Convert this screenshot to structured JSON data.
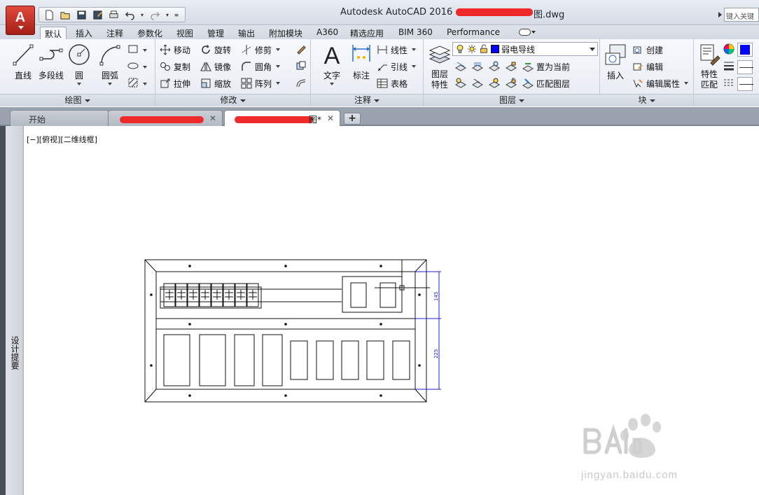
{
  "app": {
    "logo_letter": "A",
    "title": "Autodesk AutoCAD 2016",
    "title_suffix": "图.dwg",
    "search_placeholder": "键入关键"
  },
  "ribbon_tabs": [
    "默认",
    "插入",
    "注释",
    "参数化",
    "视图",
    "管理",
    "输出",
    "附加模块",
    "A360",
    "精选应用",
    "BIM 360",
    "Performance"
  ],
  "panels": {
    "draw": {
      "title": "绘图",
      "line": "直线",
      "polyline": "多段线",
      "circle": "圆",
      "arc": "圆弧"
    },
    "modify": {
      "title": "修改",
      "move": "移动",
      "rotate": "旋转",
      "trim": "修剪",
      "copy": "复制",
      "mirror": "镜像",
      "fillet": "圆角",
      "stretch": "拉伸",
      "scale": "缩放",
      "array": "阵列"
    },
    "annotation": {
      "title": "注释",
      "text": "文字",
      "dimension": "标注",
      "linear": "线性",
      "leader": "引线",
      "table": "表格"
    },
    "layers": {
      "title": "图层",
      "layer_properties": "图层\n特性",
      "current_layer": "弱电导线",
      "set_current": "置为当前",
      "match_layer": "匹配图层"
    },
    "block": {
      "title": "块",
      "insert": "插入",
      "create": "创建",
      "edit": "编辑",
      "edit_attributes": "编辑属性"
    },
    "properties": {
      "match": "特性\n匹配"
    }
  },
  "doc_tabs": {
    "start": "开始",
    "active_suffix": "图*"
  },
  "viewport_label": "[−][俯视][二维线框]",
  "palette_label": "设计提要",
  "drawing": {
    "dim_top": "145",
    "dim_bottom": "225"
  },
  "watermark": {
    "text": "jingyan.baidu.com"
  },
  "colors": {
    "layer_color": "#0000ff",
    "accent_red": "#c8281e"
  }
}
